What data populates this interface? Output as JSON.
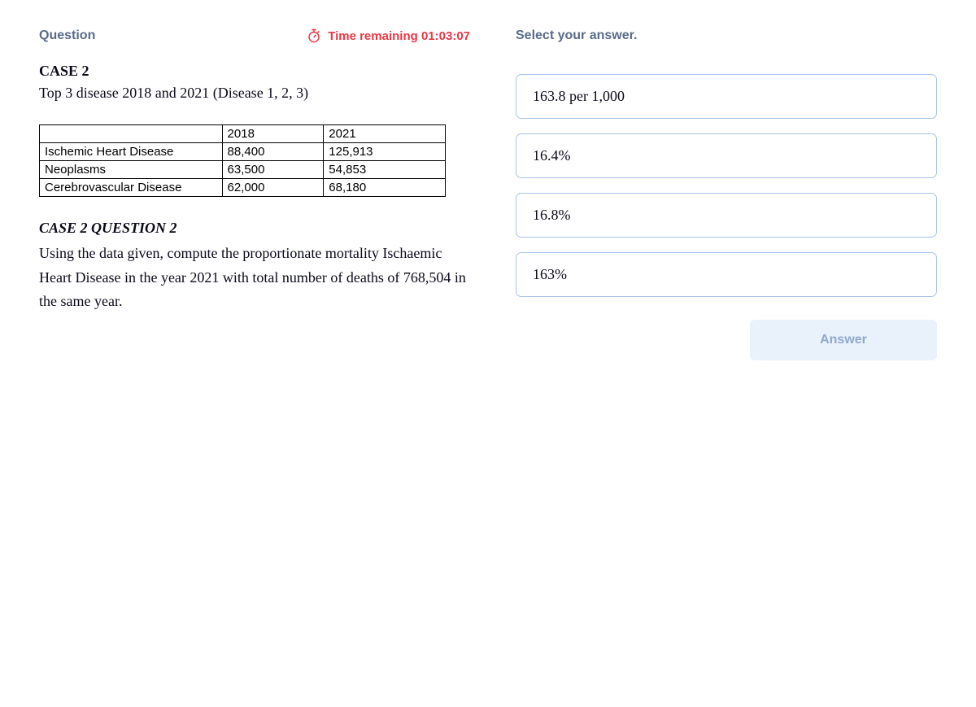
{
  "left": {
    "question_label": "Question",
    "timer_prefix": "Time remaining ",
    "timer_value": "01:03:07",
    "case_title": "CASE 2",
    "case_sub": "Top 3 disease 2018 and 2021 (Disease 1, 2, 3)",
    "table": {
      "headers": [
        "",
        "2018",
        "2021"
      ],
      "rows": [
        {
          "label": "Ischemic Heart Disease",
          "y2018": "88,400",
          "y2021": "125,913"
        },
        {
          "label": "Neoplasms",
          "y2018": "63,500",
          "y2021": "54,853"
        },
        {
          "label": "Cerebrovascular Disease",
          "y2018": "62,000",
          "y2021": "68,180"
        }
      ]
    },
    "question_heading": "CASE 2 QUESTION 2",
    "question_body": "Using the data given, compute the proportionate mortality Ischaemic Heart Disease in the year 2021 with total number of deaths of 768,504 in the same year."
  },
  "right": {
    "select_label": "Select your answer.",
    "options": [
      "163.8 per 1,000",
      "16.4%",
      "16.8%",
      "163%"
    ],
    "answer_button": "Answer"
  }
}
